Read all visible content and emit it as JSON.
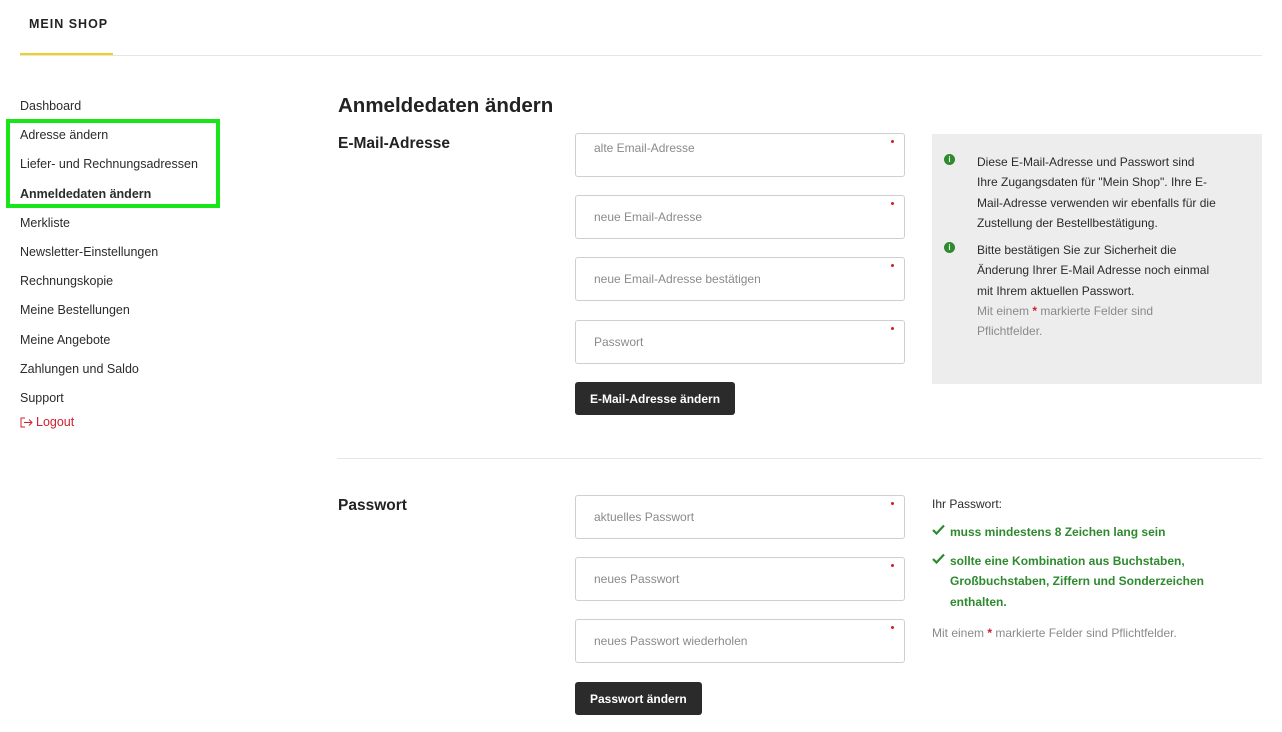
{
  "header": {
    "shop_tab": "MEIN SHOP"
  },
  "sidebar": {
    "items": [
      {
        "label": "Dashboard"
      },
      {
        "label": "Adresse ändern"
      },
      {
        "label": "Liefer- und Rechnungsadressen"
      },
      {
        "label": "Anmeldedaten ändern"
      },
      {
        "label": "Merkliste"
      },
      {
        "label": "Newsletter-Einstellungen"
      },
      {
        "label": "Rechnungskopie"
      },
      {
        "label": "Meine Bestellungen"
      },
      {
        "label": "Meine Angebote"
      },
      {
        "label": "Zahlungen und Saldo"
      },
      {
        "label": "Support"
      }
    ],
    "active_index": 3,
    "logout_label": "Logout",
    "logout_icon": "logout-arrow-icon"
  },
  "main": {
    "title": "Anmeldedaten ändern",
    "email_section": {
      "title": "E-Mail-Adresse",
      "fields": {
        "old_email": {
          "placeholder": "alte Email-Adresse",
          "value": ""
        },
        "new_email": {
          "placeholder": "neue Email-Adresse",
          "value": ""
        },
        "confirm_email": {
          "placeholder": "neue Email-Adresse bestätigen",
          "value": ""
        },
        "password": {
          "placeholder": "Passwort",
          "value": ""
        }
      },
      "submit_label": "E-Mail-Adresse ändern",
      "info": [
        "Diese E-Mail-Adresse und Passwort sind Ihre Zugangsdaten für \"Mein Shop\". Ihre E-Mail-Adresse verwenden wir ebenfalls für die Zustellung der Bestellbestätigung.",
        "Bitte bestätigen Sie zur Sicherheit die Änderung Ihrer E-Mail Adresse noch einmal mit Ihrem aktuellen Passwort."
      ],
      "required_note_prefix": "Mit einem",
      "required_note_star": "*",
      "required_note_suffix": "markierte Felder sind Pflichtfelder."
    },
    "password_section": {
      "title": "Passwort",
      "fields": {
        "current": {
          "placeholder": "aktuelles Passwort",
          "value": ""
        },
        "new": {
          "placeholder": "neues Passwort",
          "value": ""
        },
        "repeat": {
          "placeholder": "neues Passwort wiederholen",
          "value": ""
        }
      },
      "submit_label": "Passwort ändern",
      "rules_heading": "Ihr Passwort:",
      "rules": [
        "muss mindestens 8 Zeichen lang sein",
        "sollte eine Kombination aus Buchstaben, Großbuchstaben, Ziffern und Sonderzeichen enthalten."
      ],
      "required_note_prefix": "Mit einem",
      "required_note_star": "*",
      "required_note_suffix": "markierte Felder sind Pflichtfelder."
    }
  },
  "colors": {
    "accent_underline": "#f0d21c",
    "highlight_box": "#19e619",
    "required": "#d0202f",
    "success": "#2e8a2e",
    "button": "#2b2b2b"
  }
}
